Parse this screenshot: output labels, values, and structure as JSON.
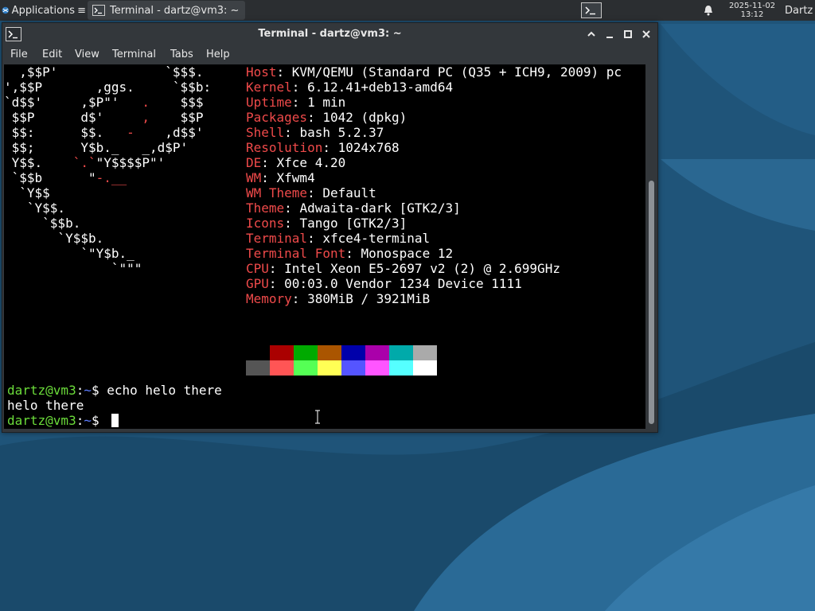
{
  "panel": {
    "apps_label": "Applications",
    "task_label": "Terminal - dartz@vm3: ~",
    "clock_date": "2025-11-02",
    "clock_time": "13:12",
    "user": "Dartz",
    "icons": {
      "apps": "xfce-mouse-icon",
      "task": "terminal-icon",
      "tray": "terminal-icon",
      "notifications": "bell-icon"
    }
  },
  "window": {
    "title": "Terminal - dartz@vm3: ~",
    "buttons": {
      "shade": "^",
      "minimize": "_",
      "maximize": "□",
      "close": "×"
    },
    "menu": [
      "File",
      "Edit",
      "View",
      "Terminal",
      "Tabs",
      "Help"
    ]
  },
  "terminal": {
    "ascii_art": [
      "  ,$$P'              `$$$.",
      "',$$P       ,ggs.     `$$b:",
      "`d$$'     ,$P\"'   .    $$$",
      " $$P      d$'     ,    $$P",
      " $$:      $$.   -    ,d$$'",
      " $$;      Y$b._   _,d$P'",
      " Y$$.    `.`\"Y$$$$P\"'",
      " `$$b      \"-.__",
      "  `Y$$",
      "   `Y$$.",
      "     `$$b.",
      "       `Y$$b.",
      "          `\"Y$b._",
      "              `\"\"\""
    ],
    "info": [
      {
        "key": "Host",
        "value": "KVM/QEMU (Standard PC (Q35 + ICH9, 2009) pc"
      },
      {
        "key": "Kernel",
        "value": "6.12.41+deb13-amd64"
      },
      {
        "key": "Uptime",
        "value": "1 min"
      },
      {
        "key": "Packages",
        "value": "1042 (dpkg)"
      },
      {
        "key": "Shell",
        "value": "bash 5.2.37"
      },
      {
        "key": "Resolution",
        "value": "1024x768"
      },
      {
        "key": "DE",
        "value": "Xfce 4.20"
      },
      {
        "key": "WM",
        "value": "Xfwm4"
      },
      {
        "key": "WM Theme",
        "value": "Default"
      },
      {
        "key": "Theme",
        "value": "Adwaita-dark [GTK2/3]"
      },
      {
        "key": "Icons",
        "value": "Tango [GTK2/3]"
      },
      {
        "key": "Terminal",
        "value": "xfce4-terminal"
      },
      {
        "key": "Terminal Font",
        "value": "Monospace 12"
      },
      {
        "key": "CPU",
        "value": "Intel Xeon E5-2697 v2 (2) @ 2.699GHz"
      },
      {
        "key": "GPU",
        "value": "00:03.0 Vendor 1234 Device 1111"
      },
      {
        "key": "Memory",
        "value": "380MiB / 3921MiB"
      }
    ],
    "separator": ": ",
    "palette_top": [
      "#000000",
      "#aa0000",
      "#00aa00",
      "#aa5500",
      "#0000aa",
      "#aa00aa",
      "#00aaaa",
      "#aaaaaa"
    ],
    "palette_bottom": [
      "#555555",
      "#ff5555",
      "#55ff55",
      "#ffff55",
      "#5555ff",
      "#ff55ff",
      "#55ffff",
      "#ffffff"
    ],
    "prompt_user": "dartz@vm3",
    "prompt_sep": ":",
    "prompt_path": "~",
    "prompt_symbol": "$ ",
    "command": "echo helo there",
    "output": "helo there"
  },
  "colors": {
    "key": "#ef4a4a",
    "prompt_user": "#6bdc3a",
    "prompt_path": "#5c7cff",
    "wallpaper": "#1d4f73"
  }
}
